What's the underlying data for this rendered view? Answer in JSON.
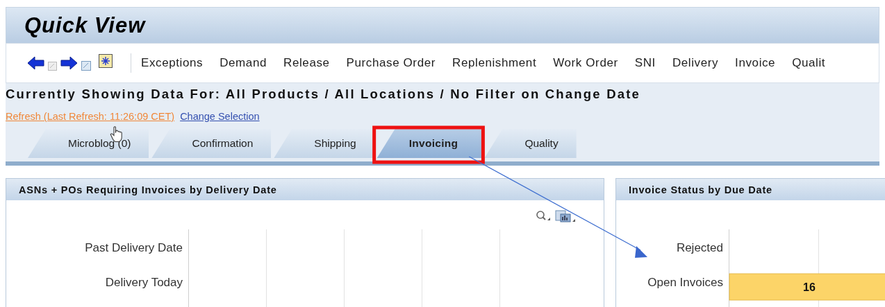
{
  "window": {
    "title": "Quick View"
  },
  "menu": [
    "Exceptions",
    "Demand",
    "Release",
    "Purchase Order",
    "Replenishment",
    "Work Order",
    "SNI",
    "Delivery",
    "Invoice",
    "Qualit"
  ],
  "filter_heading": "Currently Showing Data For: All Products / All Locations / No Filter on Change Date",
  "links": [
    {
      "kind": "refresh",
      "label": "Refresh (Last Refresh: 11:26:09 CET)"
    },
    {
      "kind": "plain",
      "label": "Change Selection"
    }
  ],
  "tabs": [
    {
      "label": "Microblog (0)",
      "selected": false,
      "outlined": false
    },
    {
      "label": "Confirmation",
      "selected": false,
      "outlined": false
    },
    {
      "label": "Shipping",
      "selected": false,
      "outlined": false
    },
    {
      "label": "Invoicing",
      "selected": true,
      "outlined": true
    },
    {
      "label": "Quality",
      "selected": false,
      "outlined": false
    }
  ],
  "callout_arrow": true,
  "panels": [
    {
      "title": "ASNs + POs Requiring Invoices by Delivery Date",
      "chart_tools": true,
      "rows": [
        {
          "label": "Past Delivery Date"
        },
        {
          "label": "Delivery Today"
        }
      ]
    },
    {
      "title": "Invoice Status by Due Date",
      "chart_tools": false,
      "chart_data": {
        "type": "bar",
        "orientation": "horizontal",
        "categories": [
          "Rejected",
          "Open Invoices"
        ],
        "values": [
          null,
          16
        ],
        "data_labels": true
      }
    }
  ]
}
